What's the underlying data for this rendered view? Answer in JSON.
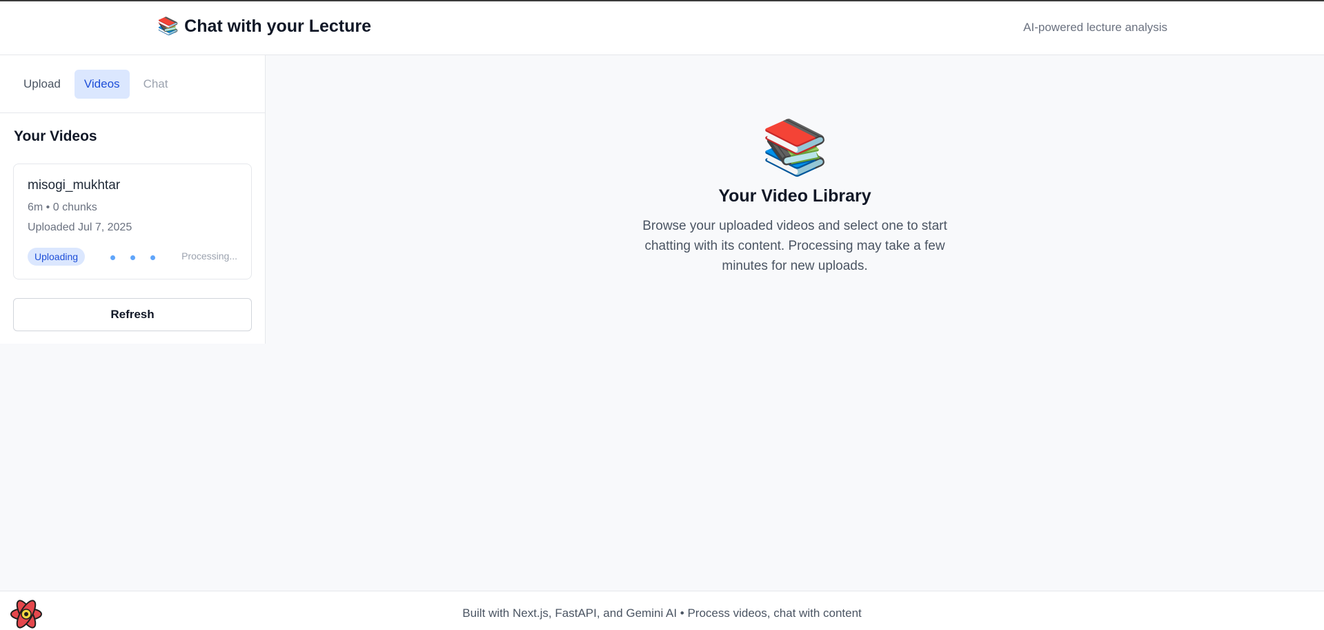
{
  "header": {
    "icon": "books-icon",
    "icon_glyph": "📚",
    "title": "Chat with your Lecture",
    "subtitle": "AI-powered lecture analysis"
  },
  "sidebar": {
    "tabs": [
      {
        "label": "Upload",
        "state": "normal"
      },
      {
        "label": "Videos",
        "state": "active"
      },
      {
        "label": "Chat",
        "state": "disabled"
      }
    ],
    "heading": "Your Videos",
    "videos": [
      {
        "name": "misogi_mukhtar",
        "meta": "6m • 0 chunks",
        "uploaded": "Uploaded Jul 7, 2025",
        "status": "Uploading",
        "progress_text": "Processing..."
      }
    ],
    "refresh_label": "Refresh"
  },
  "main": {
    "icon_glyph": "📚",
    "title": "Your Video Library",
    "description": "Browse your uploaded videos and select one to start chatting with its content. Processing may take a few minutes for new uploads."
  },
  "footer": {
    "text": "Built with Next.js, FastAPI, and Gemini AI • Process videos, chat with content"
  },
  "colors": {
    "accent": "#1d4ed8",
    "accent_bg": "#dbe7fe",
    "page_bg": "#f8f9fb",
    "dot": "#60a5fa"
  }
}
